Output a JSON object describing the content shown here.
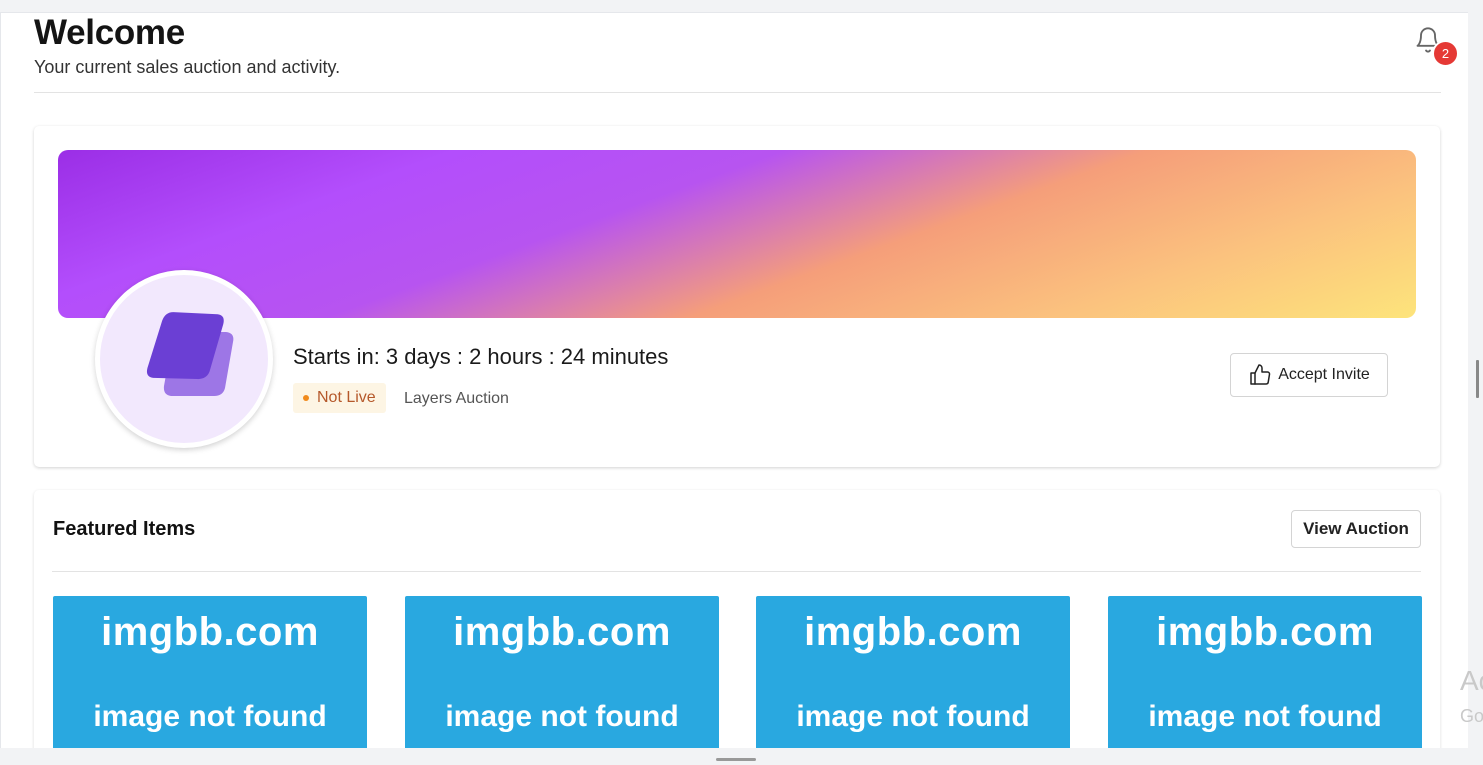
{
  "header": {
    "title": "Welcome",
    "subtitle": "Your current sales auction and activity.",
    "notification_count": "2"
  },
  "auction": {
    "countdown": "Starts in: 3 days : 2 hours : 24 minutes",
    "status": "Not Live",
    "name": "Layers Auction",
    "accept_label": "Accept Invite"
  },
  "featured": {
    "title": "Featured Items",
    "view_label": "View Auction",
    "items": [
      {
        "line1": "imgbb.com",
        "line2": "image not found"
      },
      {
        "line1": "imgbb.com",
        "line2": "image not found"
      },
      {
        "line1": "imgbb.com",
        "line2": "image not found"
      },
      {
        "line1": "imgbb.com",
        "line2": "image not found"
      }
    ]
  },
  "watermark": {
    "line1": "Ac",
    "line2": "Go"
  },
  "colors": {
    "badge": "#e53935",
    "status_bg": "#fdf5e4",
    "status_text": "#b5582a",
    "placeholder_blue": "#29a8e0"
  }
}
